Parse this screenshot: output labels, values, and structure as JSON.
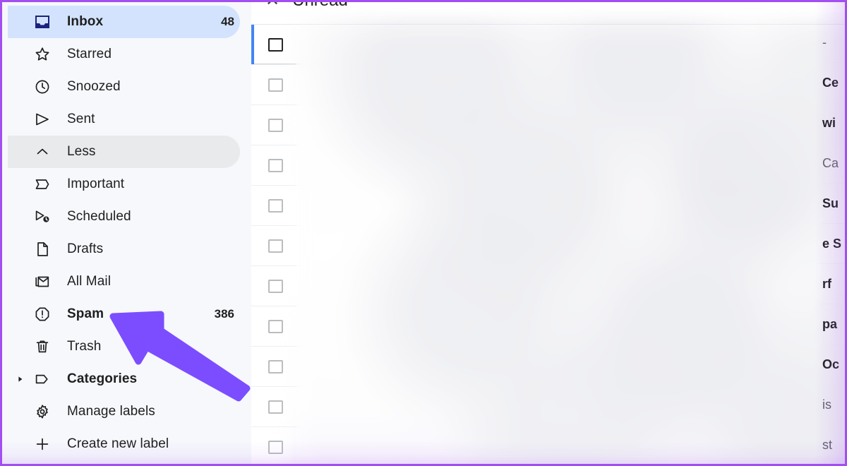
{
  "annotation": {
    "frame_color": "#a24ef0",
    "arrow_color": "#7c4dff",
    "arrow_points_to": "Spam"
  },
  "sidebar": {
    "background": "#f6f8fc",
    "active_pill_color": "#d3e3fd",
    "hover_pill_color": "#e9eaec",
    "items": [
      {
        "icon": "inbox-icon",
        "label": "Inbox",
        "count": "48",
        "state": "active",
        "bold": true,
        "caret": ""
      },
      {
        "icon": "star-icon",
        "label": "Starred",
        "count": "",
        "state": "normal",
        "bold": false,
        "caret": ""
      },
      {
        "icon": "clock-icon",
        "label": "Snoozed",
        "count": "",
        "state": "normal",
        "bold": false,
        "caret": ""
      },
      {
        "icon": "send-icon",
        "label": "Sent",
        "count": "",
        "state": "normal",
        "bold": false,
        "caret": ""
      },
      {
        "icon": "chevron-up-icon",
        "label": "Less",
        "count": "",
        "state": "hovered",
        "bold": false,
        "caret": ""
      },
      {
        "icon": "important-icon",
        "label": "Important",
        "count": "",
        "state": "normal",
        "bold": false,
        "caret": ""
      },
      {
        "icon": "scheduled-icon",
        "label": "Scheduled",
        "count": "",
        "state": "normal",
        "bold": false,
        "caret": ""
      },
      {
        "icon": "drafts-icon",
        "label": "Drafts",
        "count": "",
        "state": "normal",
        "bold": false,
        "caret": ""
      },
      {
        "icon": "all-mail-icon",
        "label": "All Mail",
        "count": "",
        "state": "normal",
        "bold": false,
        "caret": ""
      },
      {
        "icon": "spam-icon",
        "label": "Spam",
        "count": "386",
        "state": "normal",
        "bold": true,
        "caret": ""
      },
      {
        "icon": "trash-icon",
        "label": "Trash",
        "count": "",
        "state": "normal",
        "bold": false,
        "caret": ""
      },
      {
        "icon": "label-icon",
        "label": "Categories",
        "count": "",
        "state": "normal",
        "bold": true,
        "caret": "triangle-right-icon"
      },
      {
        "icon": "gear-icon",
        "label": "Manage labels",
        "count": "",
        "state": "normal",
        "bold": false,
        "caret": ""
      },
      {
        "icon": "plus-icon",
        "label": "Create new label",
        "count": "",
        "state": "normal",
        "bold": false,
        "caret": ""
      }
    ]
  },
  "mail_list": {
    "filter_chip": {
      "label": "Unread",
      "close_icon": "close-icon"
    },
    "selected_row_accent_color": "#4285f4",
    "rows": [
      {
        "checkbox": "unchecked",
        "selected": true,
        "clipped_text": "-",
        "bold": false
      },
      {
        "checkbox": "unchecked",
        "selected": false,
        "clipped_text": "Ce",
        "bold": true
      },
      {
        "checkbox": "unchecked",
        "selected": false,
        "clipped_text": "wi",
        "bold": true
      },
      {
        "checkbox": "unchecked",
        "selected": false,
        "clipped_text": "Ca",
        "bold": false
      },
      {
        "checkbox": "unchecked",
        "selected": false,
        "clipped_text": "Su",
        "bold": true
      },
      {
        "checkbox": "unchecked",
        "selected": false,
        "clipped_text": "e S",
        "bold": true
      },
      {
        "checkbox": "unchecked",
        "selected": false,
        "clipped_text": "rf",
        "bold": true
      },
      {
        "checkbox": "unchecked",
        "selected": false,
        "clipped_text": "pa",
        "bold": true
      },
      {
        "checkbox": "unchecked",
        "selected": false,
        "clipped_text": "Oc",
        "bold": true
      },
      {
        "checkbox": "unchecked",
        "selected": false,
        "clipped_text": "is",
        "bold": false
      },
      {
        "checkbox": "unchecked",
        "selected": false,
        "clipped_text": "st",
        "bold": false
      }
    ]
  }
}
